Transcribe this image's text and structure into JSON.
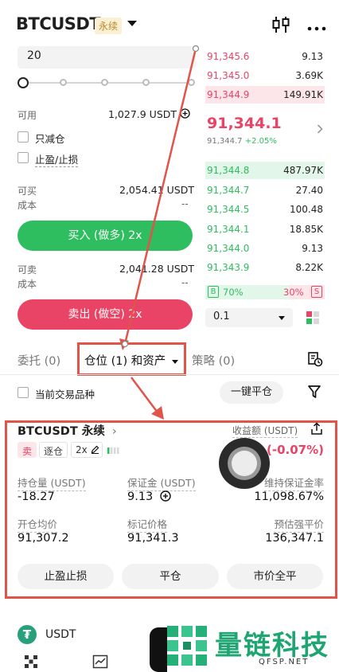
{
  "header": {
    "symbol": "BTCUSDT",
    "badge": "永续"
  },
  "order_form": {
    "amount_value": "20",
    "slider_position": 0.0,
    "available_label": "可用",
    "available_value": "1,027.9 USDT",
    "reduce_only_label": "只减仓",
    "tp_sl_label": "止盈/止损",
    "can_buy_label": "可买",
    "can_buy_value": "2,054.41 USDT",
    "cost_label_buy": "成本",
    "cost_value_buy": "--",
    "buy_button": "买入 (做多) 2x",
    "can_sell_label": "可卖",
    "can_sell_value": "2,041.28 USDT",
    "cost_label_sell": "成本",
    "cost_value_sell": "--",
    "sell_button": "卖出 (做空) 2x"
  },
  "orderbook": {
    "asks": [
      {
        "price": "91,345.6",
        "qty": "9.13",
        "depth": 0.0
      },
      {
        "price": "91,345.0",
        "qty": "3.69K",
        "depth": 0.0
      },
      {
        "price": "91,344.9",
        "qty": "149.91K",
        "depth": 1.0
      }
    ],
    "last_price": "91,344.1",
    "mark_price": "91,344.7",
    "change_pct": "+2.05%",
    "bids": [
      {
        "price": "91,344.8",
        "qty": "487.97K",
        "depth": 1.0
      },
      {
        "price": "91,344.7",
        "qty": "27.40",
        "depth": 0.0
      },
      {
        "price": "91,344.5",
        "qty": "100.48",
        "depth": 0.0
      },
      {
        "price": "91,344.1",
        "qty": "18.85K",
        "depth": 0.0
      },
      {
        "price": "91,344.0",
        "qty": "9.13",
        "depth": 0.0
      },
      {
        "price": "91,343.9",
        "qty": "8.22K",
        "depth": 0.0
      }
    ],
    "buy_ratio_tag": "B",
    "buy_ratio": "70%",
    "sell_ratio": "30%",
    "sell_ratio_tag": "S",
    "depth_value": "0.1"
  },
  "tabs": {
    "orders": "委托 (0)",
    "positions": "仓位 (1) 和资产",
    "strategy": "策略 (0)"
  },
  "filter": {
    "current_pair_label": "当前交易品种",
    "close_all_button": "一键平仓"
  },
  "position": {
    "title": "BTCUSDT 永续",
    "side_tag": "卖",
    "margin_mode_tag": "逐仓",
    "leverage_tag": "2x",
    "pnl_label": "收益额 (USDT)",
    "pnl_value": "(-0.07%)",
    "size_label": "持仓量 (USDT)",
    "size_value": "-18.27",
    "margin_label": "保证金 (USDT)",
    "margin_value": "9.13",
    "maint_margin_label": "维持保证金率",
    "maint_margin_value": "11,098.67%",
    "entry_label": "开仓均价",
    "entry_value": "91,307.2",
    "mark_label": "标记价格",
    "mark_value": "91,341.3",
    "liq_label": "预估强平价",
    "liq_value": "136,347.1",
    "btn_tpsl": "止盈止损",
    "btn_close": "平仓",
    "btn_market_close": "市价全平"
  },
  "assets": {
    "coin": "USDT"
  },
  "watermark": {
    "name": "量链科技",
    "domain": "QFSP.NET"
  },
  "colors": {
    "buy": "#2ebd5f",
    "sell": "#e94365",
    "annotation": "#e0544a"
  }
}
